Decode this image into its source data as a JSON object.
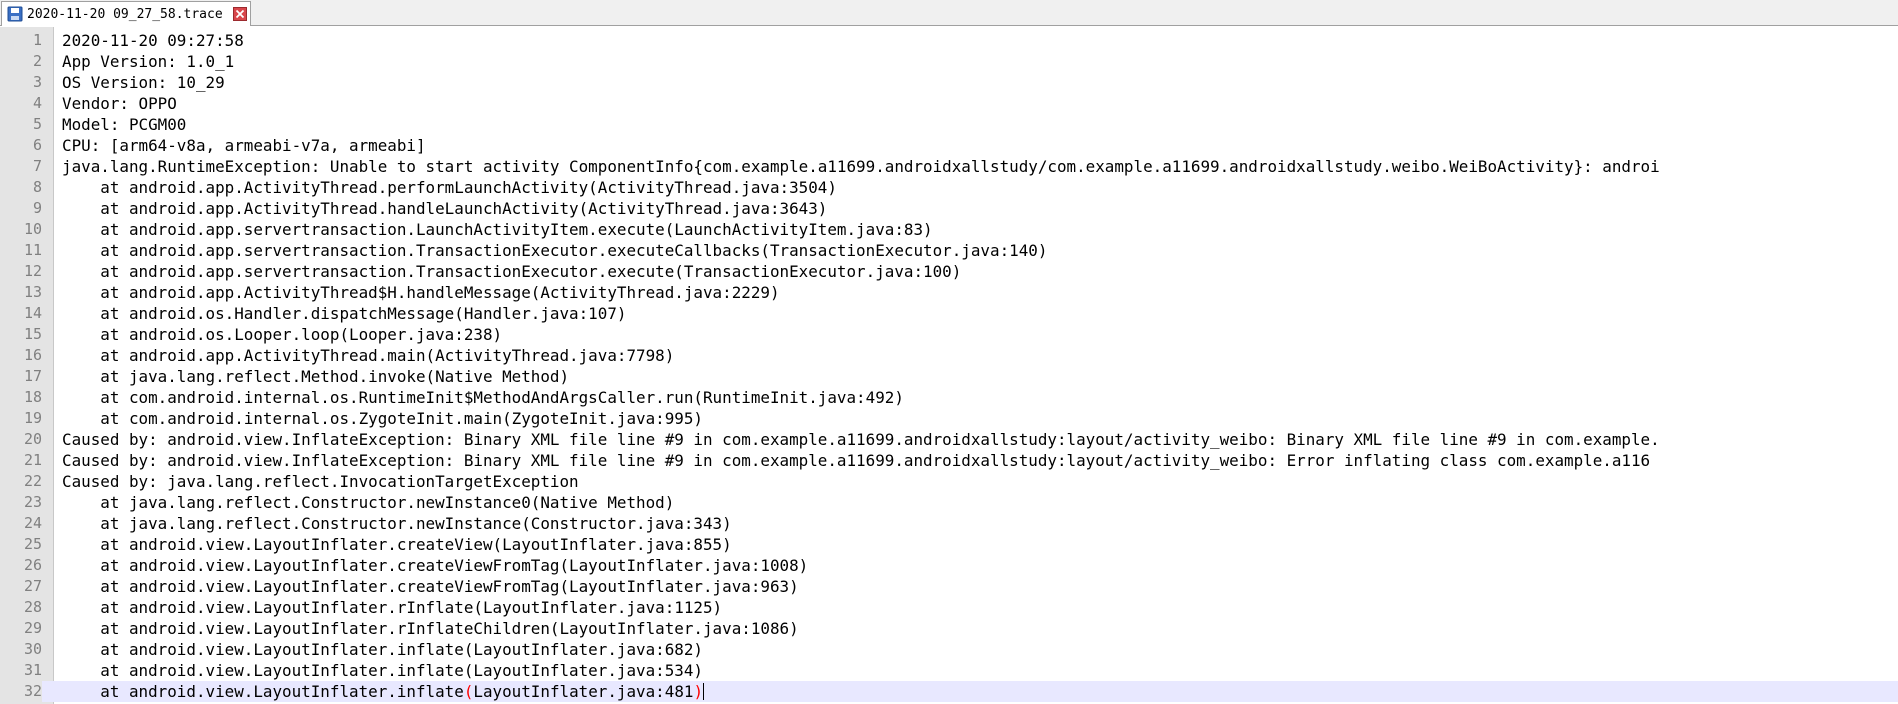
{
  "tab": {
    "title": "2020-11-20 09_27_58.trace",
    "icon": "save-disk-icon",
    "close_icon": "close-icon"
  },
  "colors": {
    "gutter_bg": "#e4e4e4",
    "current_line_bg": "#e8e8ff",
    "brace_highlight": "#ff0000",
    "line_number": "#808080"
  },
  "editor": {
    "current_line": 32,
    "lines": [
      {
        "num": "1",
        "text": "2020-11-20 09:27:58"
      },
      {
        "num": "2",
        "text": "App Version: 1.0_1"
      },
      {
        "num": "3",
        "text": "OS Version: 10_29"
      },
      {
        "num": "4",
        "text": "Vendor: OPPO"
      },
      {
        "num": "5",
        "text": "Model: PCGM00"
      },
      {
        "num": "6",
        "text": "CPU: [arm64-v8a, armeabi-v7a, armeabi]"
      },
      {
        "num": "7",
        "text": "java.lang.RuntimeException: Unable to start activity ComponentInfo{com.example.a11699.androidxallstudy/com.example.a11699.androidxallstudy.weibo.WeiBoActivity}: androi"
      },
      {
        "num": "8",
        "text": "    at android.app.ActivityThread.performLaunchActivity(ActivityThread.java:3504)"
      },
      {
        "num": "9",
        "text": "    at android.app.ActivityThread.handleLaunchActivity(ActivityThread.java:3643)"
      },
      {
        "num": "10",
        "text": "    at android.app.servertransaction.LaunchActivityItem.execute(LaunchActivityItem.java:83)"
      },
      {
        "num": "11",
        "text": "    at android.app.servertransaction.TransactionExecutor.executeCallbacks(TransactionExecutor.java:140)"
      },
      {
        "num": "12",
        "text": "    at android.app.servertransaction.TransactionExecutor.execute(TransactionExecutor.java:100)"
      },
      {
        "num": "13",
        "text": "    at android.app.ActivityThread$H.handleMessage(ActivityThread.java:2229)"
      },
      {
        "num": "14",
        "text": "    at android.os.Handler.dispatchMessage(Handler.java:107)"
      },
      {
        "num": "15",
        "text": "    at android.os.Looper.loop(Looper.java:238)"
      },
      {
        "num": "16",
        "text": "    at android.app.ActivityThread.main(ActivityThread.java:7798)"
      },
      {
        "num": "17",
        "text": "    at java.lang.reflect.Method.invoke(Native Method)"
      },
      {
        "num": "18",
        "text": "    at com.android.internal.os.RuntimeInit$MethodAndArgsCaller.run(RuntimeInit.java:492)"
      },
      {
        "num": "19",
        "text": "    at com.android.internal.os.ZygoteInit.main(ZygoteInit.java:995)"
      },
      {
        "num": "20",
        "text": "Caused by: android.view.InflateException: Binary XML file line #9 in com.example.a11699.androidxallstudy:layout/activity_weibo: Binary XML file line #9 in com.example."
      },
      {
        "num": "21",
        "text": "Caused by: android.view.InflateException: Binary XML file line #9 in com.example.a11699.androidxallstudy:layout/activity_weibo: Error inflating class com.example.a116"
      },
      {
        "num": "22",
        "text": "Caused by: java.lang.reflect.InvocationTargetException"
      },
      {
        "num": "23",
        "text": "    at java.lang.reflect.Constructor.newInstance0(Native Method)"
      },
      {
        "num": "24",
        "text": "    at java.lang.reflect.Constructor.newInstance(Constructor.java:343)"
      },
      {
        "num": "25",
        "text": "    at android.view.LayoutInflater.createView(LayoutInflater.java:855)"
      },
      {
        "num": "26",
        "text": "    at android.view.LayoutInflater.createViewFromTag(LayoutInflater.java:1008)"
      },
      {
        "num": "27",
        "text": "    at android.view.LayoutInflater.createViewFromTag(LayoutInflater.java:963)"
      },
      {
        "num": "28",
        "text": "    at android.view.LayoutInflater.rInflate(LayoutInflater.java:1125)"
      },
      {
        "num": "29",
        "text": "    at android.view.LayoutInflater.rInflateChildren(LayoutInflater.java:1086)"
      },
      {
        "num": "30",
        "text": "    at android.view.LayoutInflater.inflate(LayoutInflater.java:682)"
      },
      {
        "num": "31",
        "text": "    at android.view.LayoutInflater.inflate(LayoutInflater.java:534)"
      },
      {
        "num": "32",
        "text_before": "    at android.view.LayoutInflater.inflate",
        "open_paren": "(",
        "text_inner": "LayoutInflater.java:481",
        "close_paren": ")"
      }
    ]
  }
}
